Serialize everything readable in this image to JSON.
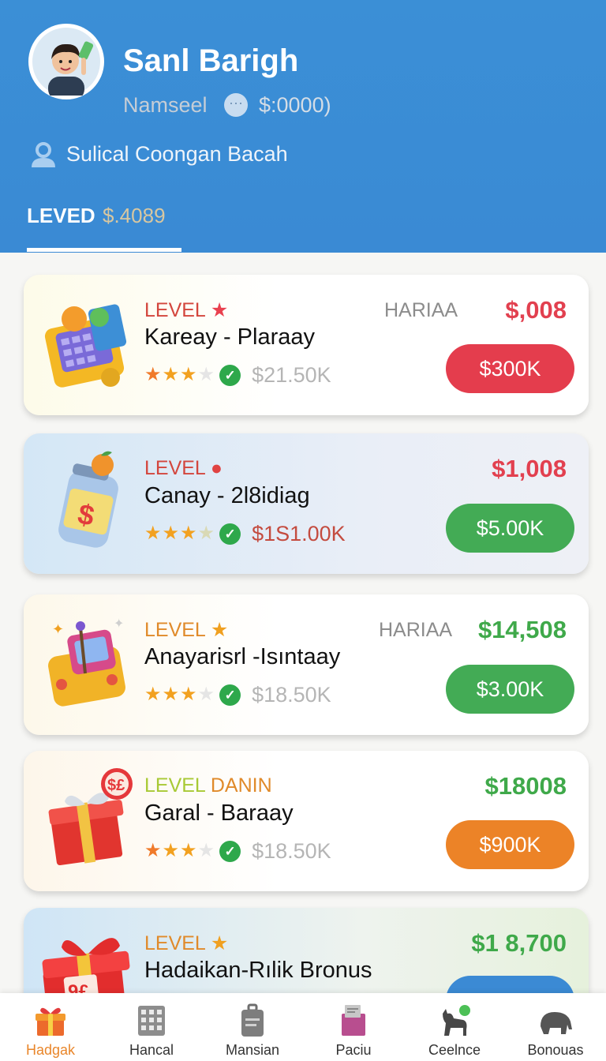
{
  "header": {
    "name": "Sanl Barigh",
    "subtitle": "Namseel",
    "balance": "$:0000)",
    "profile_text": "Sulical Coongan Bacah",
    "level_label": "LEVED",
    "level_value": "$.4089"
  },
  "cards": [
    {
      "level": "LEVEL",
      "title": "Kareay - Plaraay",
      "rank_value": "$21.50K",
      "tag": "HARIAA",
      "price": "$,008",
      "price_color": "#e2404f",
      "cta": "$300K",
      "cta_color": "#e43d4d",
      "stars": 3,
      "icon": "calculator-icon"
    },
    {
      "level": "LEVEL",
      "title": "Canay - 2l8idiag",
      "rank_value": "$1S1.00K",
      "tag": "",
      "price": "$1,008",
      "price_color": "#e2404f",
      "cta": "$5.00K",
      "cta_color": "#43ab55",
      "stars": 3,
      "icon": "money-jar-icon"
    },
    {
      "level": "LEVEL",
      "title": "Anayarisrl -Isıntaay",
      "rank_value": "$18.50K",
      "tag": "HARIAA",
      "price": "$14,508",
      "price_color": "#3fa94a",
      "cta": "$3.00K",
      "cta_color": "#43ab55",
      "stars": 3,
      "icon": "arcade-machine-icon"
    },
    {
      "level": "LEVEL DANIN",
      "title": "Garal - Baraay",
      "rank_value": "$18.50K",
      "tag": "",
      "price": "$18008",
      "price_color": "#3fa94a",
      "cta": "$900K",
      "cta_color": "#ec8327",
      "stars": 3,
      "icon": "gift-box-icon"
    },
    {
      "level": "LEVEL",
      "title": "Hadaikan-Rılik Bronus",
      "rank_value": "",
      "tag": "",
      "price": "$1 8,700",
      "price_color": "#3fa94a",
      "cta": "",
      "cta_color": "#3b8ad4",
      "stars": 0,
      "icon": "red-gift-icon"
    }
  ],
  "nav": [
    {
      "label": "Hadgak",
      "icon": "gift-icon",
      "active": true
    },
    {
      "label": "Hancal",
      "icon": "grid-icon",
      "active": false
    },
    {
      "label": "Mansian",
      "icon": "briefcase-icon",
      "active": false
    },
    {
      "label": "Paciu",
      "icon": "box-icon",
      "active": false
    },
    {
      "label": "Ceelnce",
      "icon": "animal-icon",
      "active": false
    },
    {
      "label": "Bonouas",
      "icon": "elephant-icon",
      "active": false
    }
  ],
  "colors": {
    "header_bg": "#3b8fd6",
    "accent_orange": "#e9862a",
    "star": "#f2a120",
    "check": "#2ea84b"
  }
}
